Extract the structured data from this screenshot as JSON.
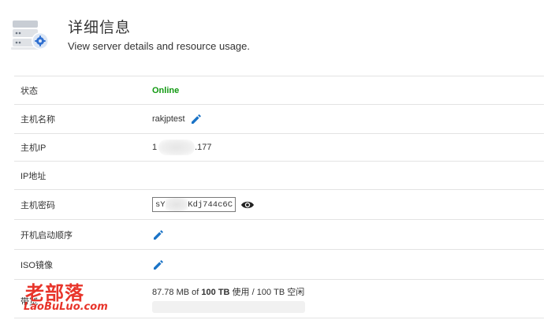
{
  "header": {
    "title": "详细信息",
    "subtitle": "View server details and resource usage."
  },
  "rows": {
    "status": {
      "label": "状态",
      "value": "Online"
    },
    "hostname": {
      "label": "主机名称",
      "value": "rakjptest"
    },
    "host_ip": {
      "label": "主机IP",
      "prefix": "1",
      "suffix": ".177"
    },
    "ip_address": {
      "label": "IP地址",
      "value": ""
    },
    "password": {
      "label": "主机密码",
      "prefix": "sY",
      "suffix": "Kdj744c6C"
    },
    "boot_order": {
      "label": "开机启动顺序"
    },
    "iso": {
      "label": "ISO镜像"
    },
    "bandwidth": {
      "label": "带宽",
      "used": "87.78 MB",
      "of": "of",
      "total": "100 TB",
      "used_word": "使用",
      "sep": "/",
      "free": "100 TB",
      "free_word": "空闲",
      "usage_fraction": 0.0
    }
  },
  "watermark": {
    "cn": "老部落",
    "en": "LaoBuLuo.com"
  },
  "colors": {
    "online": "#119911",
    "accent": "#1a73c7",
    "watermark": "#e8342a"
  },
  "icons": [
    "server-icon",
    "gear-icon",
    "pencil-icon",
    "eye-icon"
  ]
}
